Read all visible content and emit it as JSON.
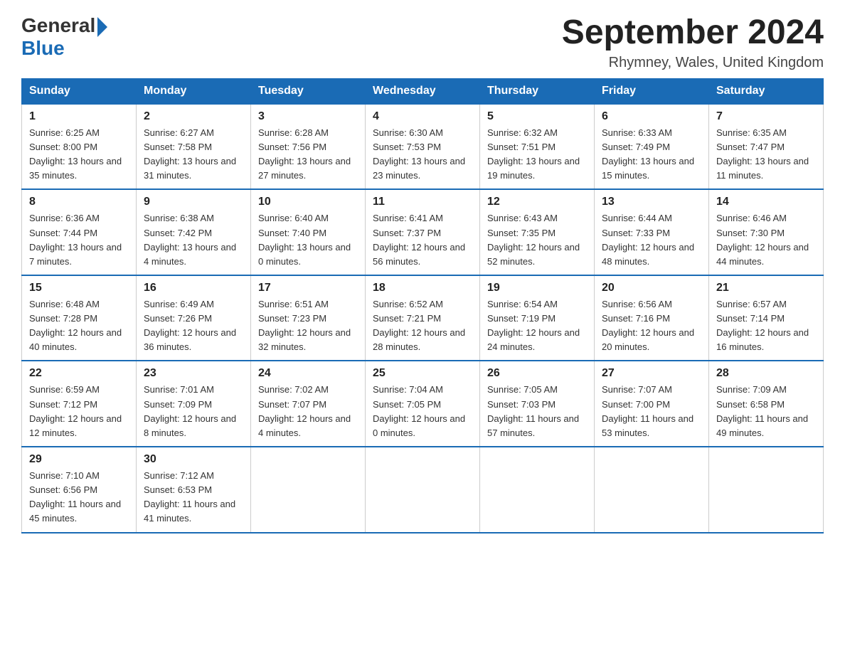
{
  "header": {
    "logo_general": "General",
    "logo_blue": "Blue",
    "month_title": "September 2024",
    "subtitle": "Rhymney, Wales, United Kingdom"
  },
  "days_of_week": [
    "Sunday",
    "Monday",
    "Tuesday",
    "Wednesday",
    "Thursday",
    "Friday",
    "Saturday"
  ],
  "weeks": [
    [
      {
        "day": "1",
        "sunrise": "6:25 AM",
        "sunset": "8:00 PM",
        "daylight": "13 hours and 35 minutes."
      },
      {
        "day": "2",
        "sunrise": "6:27 AM",
        "sunset": "7:58 PM",
        "daylight": "13 hours and 31 minutes."
      },
      {
        "day": "3",
        "sunrise": "6:28 AM",
        "sunset": "7:56 PM",
        "daylight": "13 hours and 27 minutes."
      },
      {
        "day": "4",
        "sunrise": "6:30 AM",
        "sunset": "7:53 PM",
        "daylight": "13 hours and 23 minutes."
      },
      {
        "day": "5",
        "sunrise": "6:32 AM",
        "sunset": "7:51 PM",
        "daylight": "13 hours and 19 minutes."
      },
      {
        "day": "6",
        "sunrise": "6:33 AM",
        "sunset": "7:49 PM",
        "daylight": "13 hours and 15 minutes."
      },
      {
        "day": "7",
        "sunrise": "6:35 AM",
        "sunset": "7:47 PM",
        "daylight": "13 hours and 11 minutes."
      }
    ],
    [
      {
        "day": "8",
        "sunrise": "6:36 AM",
        "sunset": "7:44 PM",
        "daylight": "13 hours and 7 minutes."
      },
      {
        "day": "9",
        "sunrise": "6:38 AM",
        "sunset": "7:42 PM",
        "daylight": "13 hours and 4 minutes."
      },
      {
        "day": "10",
        "sunrise": "6:40 AM",
        "sunset": "7:40 PM",
        "daylight": "13 hours and 0 minutes."
      },
      {
        "day": "11",
        "sunrise": "6:41 AM",
        "sunset": "7:37 PM",
        "daylight": "12 hours and 56 minutes."
      },
      {
        "day": "12",
        "sunrise": "6:43 AM",
        "sunset": "7:35 PM",
        "daylight": "12 hours and 52 minutes."
      },
      {
        "day": "13",
        "sunrise": "6:44 AM",
        "sunset": "7:33 PM",
        "daylight": "12 hours and 48 minutes."
      },
      {
        "day": "14",
        "sunrise": "6:46 AM",
        "sunset": "7:30 PM",
        "daylight": "12 hours and 44 minutes."
      }
    ],
    [
      {
        "day": "15",
        "sunrise": "6:48 AM",
        "sunset": "7:28 PM",
        "daylight": "12 hours and 40 minutes."
      },
      {
        "day": "16",
        "sunrise": "6:49 AM",
        "sunset": "7:26 PM",
        "daylight": "12 hours and 36 minutes."
      },
      {
        "day": "17",
        "sunrise": "6:51 AM",
        "sunset": "7:23 PM",
        "daylight": "12 hours and 32 minutes."
      },
      {
        "day": "18",
        "sunrise": "6:52 AM",
        "sunset": "7:21 PM",
        "daylight": "12 hours and 28 minutes."
      },
      {
        "day": "19",
        "sunrise": "6:54 AM",
        "sunset": "7:19 PM",
        "daylight": "12 hours and 24 minutes."
      },
      {
        "day": "20",
        "sunrise": "6:56 AM",
        "sunset": "7:16 PM",
        "daylight": "12 hours and 20 minutes."
      },
      {
        "day": "21",
        "sunrise": "6:57 AM",
        "sunset": "7:14 PM",
        "daylight": "12 hours and 16 minutes."
      }
    ],
    [
      {
        "day": "22",
        "sunrise": "6:59 AM",
        "sunset": "7:12 PM",
        "daylight": "12 hours and 12 minutes."
      },
      {
        "day": "23",
        "sunrise": "7:01 AM",
        "sunset": "7:09 PM",
        "daylight": "12 hours and 8 minutes."
      },
      {
        "day": "24",
        "sunrise": "7:02 AM",
        "sunset": "7:07 PM",
        "daylight": "12 hours and 4 minutes."
      },
      {
        "day": "25",
        "sunrise": "7:04 AM",
        "sunset": "7:05 PM",
        "daylight": "12 hours and 0 minutes."
      },
      {
        "day": "26",
        "sunrise": "7:05 AM",
        "sunset": "7:03 PM",
        "daylight": "11 hours and 57 minutes."
      },
      {
        "day": "27",
        "sunrise": "7:07 AM",
        "sunset": "7:00 PM",
        "daylight": "11 hours and 53 minutes."
      },
      {
        "day": "28",
        "sunrise": "7:09 AM",
        "sunset": "6:58 PM",
        "daylight": "11 hours and 49 minutes."
      }
    ],
    [
      {
        "day": "29",
        "sunrise": "7:10 AM",
        "sunset": "6:56 PM",
        "daylight": "11 hours and 45 minutes."
      },
      {
        "day": "30",
        "sunrise": "7:12 AM",
        "sunset": "6:53 PM",
        "daylight": "11 hours and 41 minutes."
      },
      null,
      null,
      null,
      null,
      null
    ]
  ]
}
